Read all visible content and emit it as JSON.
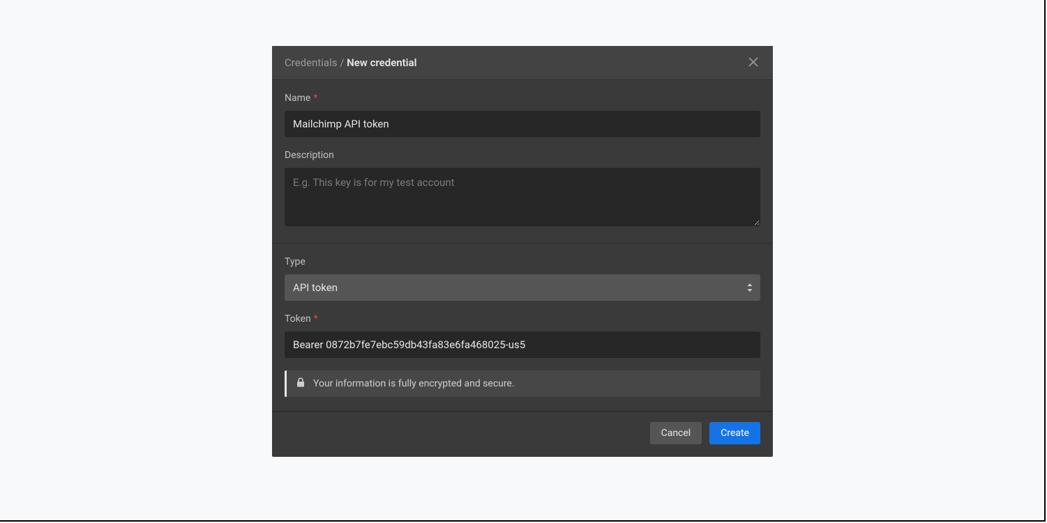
{
  "header": {
    "breadcrumb_root": "Credentials",
    "breadcrumb_sep": " / ",
    "breadcrumb_current": "New credential"
  },
  "fields": {
    "name": {
      "label": "Name",
      "required_marker": "*",
      "value": "Mailchimp API token"
    },
    "description": {
      "label": "Description",
      "placeholder": "E.g. This key is for my test account",
      "value": ""
    },
    "type": {
      "label": "Type",
      "selected": "API token"
    },
    "token": {
      "label": "Token",
      "required_marker": "*",
      "value": "Bearer 0872b7fe7ebc59db43fa83e6fa468025-us5"
    }
  },
  "banner": {
    "text": "Your information is fully encrypted and secure."
  },
  "footer": {
    "cancel": "Cancel",
    "create": "Create"
  }
}
